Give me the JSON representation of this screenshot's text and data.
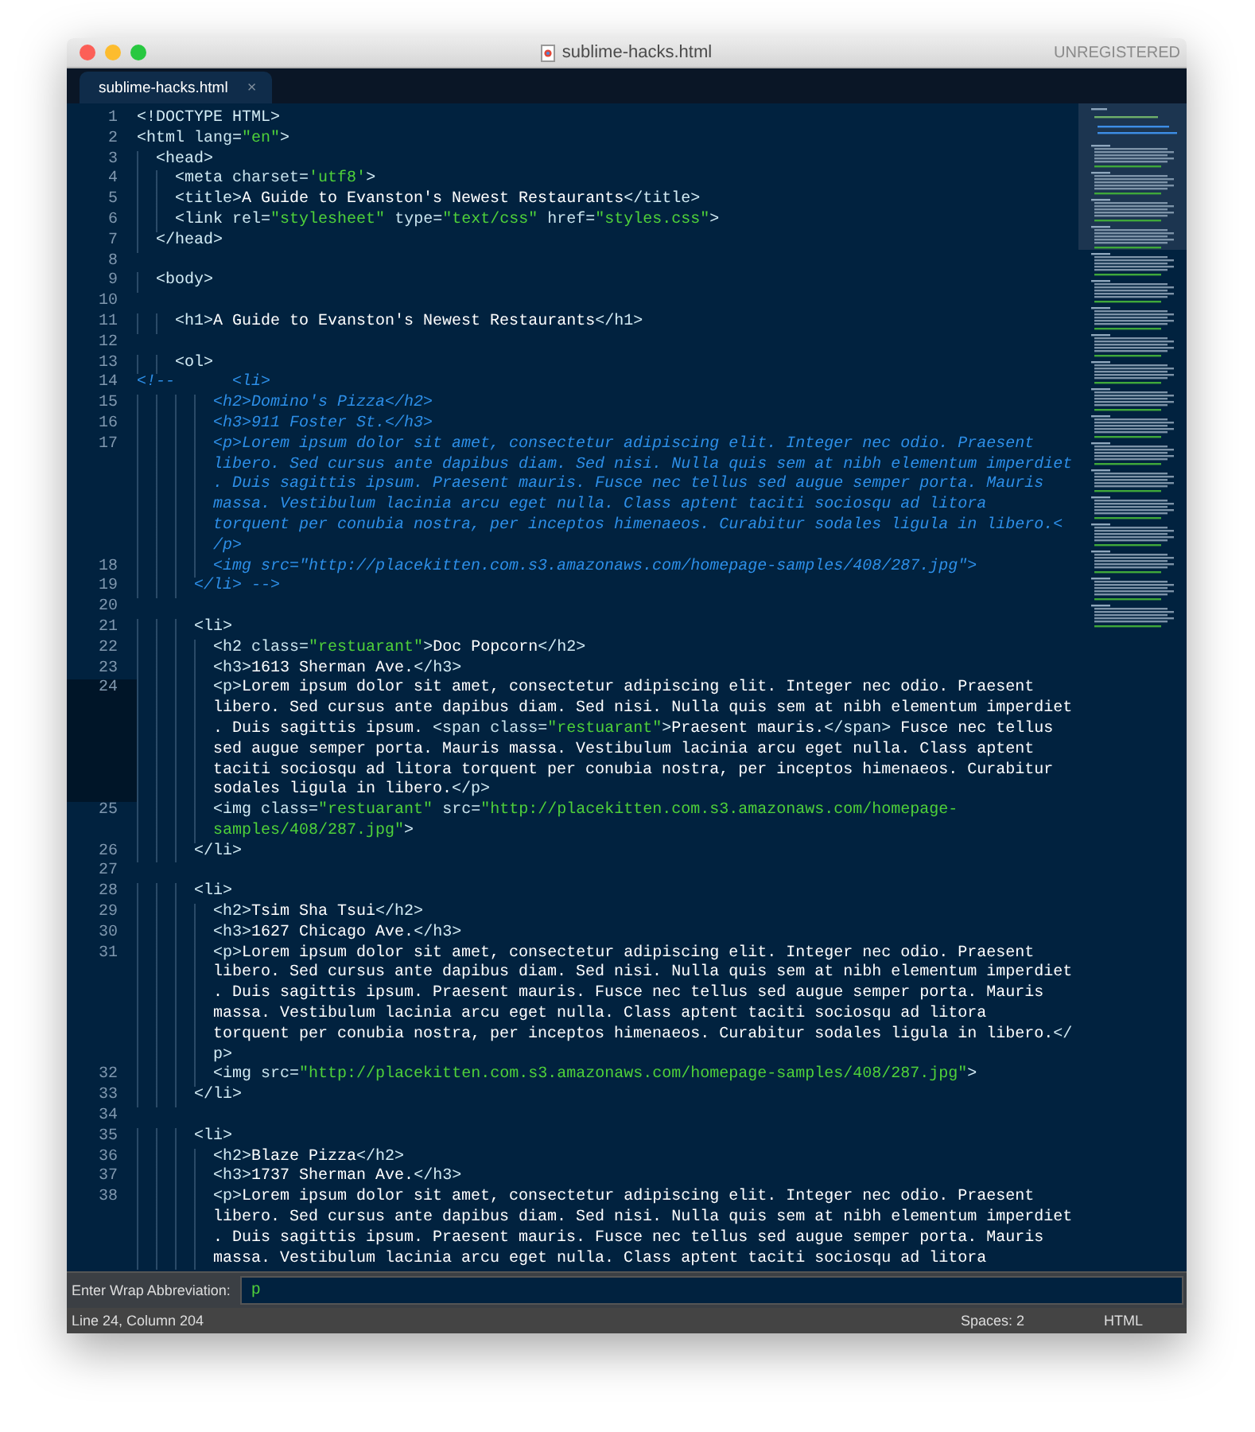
{
  "window": {
    "title": "sublime-hacks.html",
    "registration": "UNREGISTERED"
  },
  "tabs": [
    {
      "label": "sublime-hacks.html",
      "close": "×",
      "selected": true
    }
  ],
  "editor": {
    "lines": [
      {
        "number": "1",
        "current": false,
        "rows": [
          {
            "indent": "",
            "tokens": [
              {
                "kind": "tag",
                "text": "<!DOCTYPE HTML>"
              }
            ]
          }
        ]
      },
      {
        "number": "2",
        "current": false,
        "rows": [
          {
            "indent": "",
            "tokens": [
              {
                "kind": "tag",
                "text": "<html"
              },
              {
                "kind": "attr",
                "text": " lang="
              },
              {
                "kind": "string",
                "text": "\"en\""
              },
              {
                "kind": "tag",
                "text": ">"
              }
            ]
          }
        ]
      },
      {
        "number": "3",
        "current": false,
        "rows": [
          {
            "indent": "  ",
            "tokens": [
              {
                "kind": "tag",
                "text": "<head>"
              }
            ]
          }
        ]
      },
      {
        "number": "4",
        "current": false,
        "rows": [
          {
            "indent": "    ",
            "tokens": [
              {
                "kind": "tag",
                "text": "<meta"
              },
              {
                "kind": "attr",
                "text": " charset="
              },
              {
                "kind": "string",
                "text": "'utf8'"
              },
              {
                "kind": "tag",
                "text": ">"
              }
            ]
          }
        ]
      },
      {
        "number": "5",
        "current": false,
        "rows": [
          {
            "indent": "    ",
            "tokens": [
              {
                "kind": "tag",
                "text": "<title>"
              },
              {
                "kind": "text",
                "text": "A Guide to Evanston's Newest Restaurants"
              },
              {
                "kind": "tag",
                "text": "</title>"
              }
            ]
          }
        ]
      },
      {
        "number": "6",
        "current": false,
        "rows": [
          {
            "indent": "    ",
            "tokens": [
              {
                "kind": "tag",
                "text": "<link"
              },
              {
                "kind": "attr",
                "text": " rel="
              },
              {
                "kind": "string",
                "text": "\"stylesheet\""
              },
              {
                "kind": "attr",
                "text": " type="
              },
              {
                "kind": "string",
                "text": "\"text/css\""
              },
              {
                "kind": "attr",
                "text": " href="
              },
              {
                "kind": "string",
                "text": "\"styles.css\""
              },
              {
                "kind": "tag",
                "text": ">"
              }
            ]
          }
        ]
      },
      {
        "number": "7",
        "current": false,
        "rows": [
          {
            "indent": "  ",
            "tokens": [
              {
                "kind": "tag",
                "text": "</head>"
              }
            ]
          }
        ]
      },
      {
        "number": "8",
        "current": false
      },
      {
        "number": "9",
        "current": false,
        "rows": [
          {
            "indent": "  ",
            "tokens": [
              {
                "kind": "tag",
                "text": "<body>"
              }
            ]
          }
        ]
      },
      {
        "number": "10",
        "current": false
      },
      {
        "number": "11",
        "current": false,
        "rows": [
          {
            "indent": "    ",
            "tokens": [
              {
                "kind": "tag",
                "text": "<h1>"
              },
              {
                "kind": "text",
                "text": "A Guide to Evanston's Newest Restaurants"
              },
              {
                "kind": "tag",
                "text": "</h1>"
              }
            ]
          }
        ]
      },
      {
        "number": "12",
        "current": false
      },
      {
        "number": "13",
        "current": false,
        "rows": [
          {
            "indent": "    ",
            "tokens": [
              {
                "kind": "tag",
                "text": "<ol>"
              }
            ]
          }
        ]
      },
      {
        "number": "14",
        "current": false,
        "rows": [
          {
            "indent": "",
            "tokens": [
              {
                "kind": "comment",
                "text": "<!--      <li>"
              }
            ]
          }
        ]
      },
      {
        "number": "15",
        "current": false,
        "rows": [
          {
            "indent": "        ",
            "tokens": [
              {
                "kind": "comment",
                "text": "<h2>Domino's Pizza</h2>"
              }
            ]
          }
        ]
      },
      {
        "number": "16",
        "current": false,
        "rows": [
          {
            "indent": "        ",
            "tokens": [
              {
                "kind": "comment",
                "text": "<h3>911 Foster St.</h3>"
              }
            ]
          }
        ]
      },
      {
        "number": "17",
        "current": false,
        "rows": [
          {
            "indent": "        ",
            "tokens": [
              {
                "kind": "comment",
                "text": "<p>Lorem ipsum dolor sit amet, consectetur adipiscing elit. Integer nec odio. Praesent"
              }
            ]
          },
          {
            "indent": "        ",
            "tokens": [
              {
                "kind": "comment",
                "text": "libero. Sed cursus ante dapibus diam. Sed nisi. Nulla quis sem at nibh elementum imperdiet"
              }
            ]
          },
          {
            "indent": "        ",
            "tokens": [
              {
                "kind": "comment",
                "text": ". Duis sagittis ipsum. Praesent mauris. Fusce nec tellus sed augue semper porta. Mauris"
              }
            ]
          },
          {
            "indent": "        ",
            "tokens": [
              {
                "kind": "comment",
                "text": "massa. Vestibulum lacinia arcu eget nulla. Class aptent taciti sociosqu ad litora"
              }
            ]
          },
          {
            "indent": "        ",
            "tokens": [
              {
                "kind": "comment",
                "text": "torquent per conubia nostra, per inceptos himenaeos. Curabitur sodales ligula in libero.<"
              }
            ]
          },
          {
            "indent": "        ",
            "tokens": [
              {
                "kind": "comment",
                "text": "/p>"
              }
            ]
          }
        ]
      },
      {
        "number": "18",
        "current": false,
        "rows": [
          {
            "indent": "        ",
            "tokens": [
              {
                "kind": "comment",
                "text": "<img src=\"http://placekitten.com.s3.amazonaws.com/homepage-samples/408/287.jpg\">"
              }
            ]
          }
        ]
      },
      {
        "number": "19",
        "current": false,
        "rows": [
          {
            "indent": "      ",
            "tokens": [
              {
                "kind": "comment",
                "text": "</li> -->"
              }
            ]
          }
        ]
      },
      {
        "number": "20",
        "current": false
      },
      {
        "number": "21",
        "current": false,
        "rows": [
          {
            "indent": "      ",
            "tokens": [
              {
                "kind": "tag",
                "text": "<li>"
              }
            ]
          }
        ]
      },
      {
        "number": "22",
        "current": false,
        "rows": [
          {
            "indent": "        ",
            "tokens": [
              {
                "kind": "tag",
                "text": "<h2"
              },
              {
                "kind": "attr",
                "text": " class="
              },
              {
                "kind": "string",
                "text": "\"restuarant\""
              },
              {
                "kind": "tag",
                "text": ">"
              },
              {
                "kind": "text",
                "text": "Doc Popcorn"
              },
              {
                "kind": "tag",
                "text": "</h2>"
              }
            ]
          }
        ]
      },
      {
        "number": "23",
        "current": false,
        "rows": [
          {
            "indent": "        ",
            "tokens": [
              {
                "kind": "tag",
                "text": "<h3>"
              },
              {
                "kind": "text",
                "text": "1613 Sherman Ave."
              },
              {
                "kind": "tag",
                "text": "</h3>"
              }
            ]
          }
        ]
      },
      {
        "number": "24",
        "current": true,
        "rows": [
          {
            "indent": "        ",
            "tokens": [
              {
                "kind": "tag",
                "text": "<p>"
              },
              {
                "kind": "text",
                "text": "Lorem ipsum dolor sit amet, consectetur adipiscing elit. Integer nec odio. Praesent"
              }
            ]
          },
          {
            "indent": "        ",
            "tokens": [
              {
                "kind": "text",
                "text": "libero. Sed cursus ante dapibus diam. Sed nisi. Nulla quis sem at nibh elementum imperdiet"
              }
            ]
          },
          {
            "indent": "        ",
            "tokens": [
              {
                "kind": "text",
                "text": ". Duis sagittis ipsum. "
              },
              {
                "kind": "tag",
                "text": "<span"
              },
              {
                "kind": "attr",
                "text": " class="
              },
              {
                "kind": "string",
                "text": "\"restuarant\""
              },
              {
                "kind": "tag",
                "text": ">"
              },
              {
                "kind": "text",
                "text": "Praesent mauris."
              },
              {
                "kind": "tag",
                "text": "</span>"
              },
              {
                "kind": "text",
                "text": " Fusce nec tellus"
              }
            ]
          },
          {
            "indent": "        ",
            "tokens": [
              {
                "kind": "text",
                "text": "sed augue semper porta. Mauris massa. Vestibulum lacinia arcu eget nulla. Class aptent"
              }
            ]
          },
          {
            "indent": "        ",
            "tokens": [
              {
                "kind": "text",
                "text": "taciti sociosqu ad litora torquent per conubia nostra, per inceptos himenaeos. Curabitur"
              }
            ]
          },
          {
            "indent": "        ",
            "tokens": [
              {
                "kind": "text",
                "text": "sodales ligula in libero."
              },
              {
                "kind": "tag",
                "text": "</p>"
              }
            ]
          }
        ]
      },
      {
        "number": "25",
        "current": false,
        "rows": [
          {
            "indent": "        ",
            "tokens": [
              {
                "kind": "tag",
                "text": "<img"
              },
              {
                "kind": "attr",
                "text": " class="
              },
              {
                "kind": "string",
                "text": "\"restuarant\""
              },
              {
                "kind": "attr",
                "text": " src="
              },
              {
                "kind": "string",
                "text": "\"http://placekitten.com.s3.amazonaws.com/homepage-"
              }
            ]
          },
          {
            "indent": "        ",
            "tokens": [
              {
                "kind": "string",
                "text": "samples/408/287.jpg\""
              },
              {
                "kind": "tag",
                "text": ">"
              }
            ]
          }
        ]
      },
      {
        "number": "26",
        "current": false,
        "rows": [
          {
            "indent": "      ",
            "tokens": [
              {
                "kind": "tag",
                "text": "</li>"
              }
            ]
          }
        ]
      },
      {
        "number": "27",
        "current": false
      },
      {
        "number": "28",
        "current": false,
        "rows": [
          {
            "indent": "      ",
            "tokens": [
              {
                "kind": "tag",
                "text": "<li>"
              }
            ]
          }
        ]
      },
      {
        "number": "29",
        "current": false,
        "rows": [
          {
            "indent": "        ",
            "tokens": [
              {
                "kind": "tag",
                "text": "<h2>"
              },
              {
                "kind": "text",
                "text": "Tsim Sha Tsui"
              },
              {
                "kind": "tag",
                "text": "</h2>"
              }
            ]
          }
        ]
      },
      {
        "number": "30",
        "current": false,
        "rows": [
          {
            "indent": "        ",
            "tokens": [
              {
                "kind": "tag",
                "text": "<h3>"
              },
              {
                "kind": "text",
                "text": "1627 Chicago Ave."
              },
              {
                "kind": "tag",
                "text": "</h3>"
              }
            ]
          }
        ]
      },
      {
        "number": "31",
        "current": false,
        "rows": [
          {
            "indent": "        ",
            "tokens": [
              {
                "kind": "tag",
                "text": "<p>"
              },
              {
                "kind": "text",
                "text": "Lorem ipsum dolor sit amet, consectetur adipiscing elit. Integer nec odio. Praesent"
              }
            ]
          },
          {
            "indent": "        ",
            "tokens": [
              {
                "kind": "text",
                "text": "libero. Sed cursus ante dapibus diam. Sed nisi. Nulla quis sem at nibh elementum imperdiet"
              }
            ]
          },
          {
            "indent": "        ",
            "tokens": [
              {
                "kind": "text",
                "text": ". Duis sagittis ipsum. Praesent mauris. Fusce nec tellus sed augue semper porta. Mauris"
              }
            ]
          },
          {
            "indent": "        ",
            "tokens": [
              {
                "kind": "text",
                "text": "massa. Vestibulum lacinia arcu eget nulla. Class aptent taciti sociosqu ad litora"
              }
            ]
          },
          {
            "indent": "        ",
            "tokens": [
              {
                "kind": "text",
                "text": "torquent per conubia nostra, per inceptos himenaeos. Curabitur sodales ligula in libero."
              },
              {
                "kind": "tag",
                "text": "</"
              }
            ]
          },
          {
            "indent": "        ",
            "tokens": [
              {
                "kind": "tag",
                "text": "p>"
              }
            ]
          }
        ]
      },
      {
        "number": "32",
        "current": false,
        "rows": [
          {
            "indent": "        ",
            "tokens": [
              {
                "kind": "tag",
                "text": "<img"
              },
              {
                "kind": "attr",
                "text": " src="
              },
              {
                "kind": "string",
                "text": "\"http://placekitten.com.s3.amazonaws.com/homepage-samples/408/287.jpg\""
              },
              {
                "kind": "tag",
                "text": ">"
              }
            ]
          }
        ]
      },
      {
        "number": "33",
        "current": false,
        "rows": [
          {
            "indent": "      ",
            "tokens": [
              {
                "kind": "tag",
                "text": "</li>"
              }
            ]
          }
        ]
      },
      {
        "number": "34",
        "current": false
      },
      {
        "number": "35",
        "current": false,
        "rows": [
          {
            "indent": "      ",
            "tokens": [
              {
                "kind": "tag",
                "text": "<li>"
              }
            ]
          }
        ]
      },
      {
        "number": "36",
        "current": false,
        "rows": [
          {
            "indent": "        ",
            "tokens": [
              {
                "kind": "tag",
                "text": "<h2>"
              },
              {
                "kind": "text",
                "text": "Blaze Pizza"
              },
              {
                "kind": "tag",
                "text": "</h2>"
              }
            ]
          }
        ]
      },
      {
        "number": "37",
        "current": false,
        "rows": [
          {
            "indent": "        ",
            "tokens": [
              {
                "kind": "tag",
                "text": "<h3>"
              },
              {
                "kind": "text",
                "text": "1737 Sherman Ave."
              },
              {
                "kind": "tag",
                "text": "</h3>"
              }
            ]
          }
        ]
      },
      {
        "number": "38",
        "current": false,
        "rows": [
          {
            "indent": "        ",
            "tokens": [
              {
                "kind": "tag",
                "text": "<p>"
              },
              {
                "kind": "text",
                "text": "Lorem ipsum dolor sit amet, consectetur adipiscing elit. Integer nec odio. Praesent"
              }
            ]
          },
          {
            "indent": "        ",
            "tokens": [
              {
                "kind": "text",
                "text": "libero. Sed cursus ante dapibus diam. Sed nisi. Nulla quis sem at nibh elementum imperdiet"
              }
            ]
          },
          {
            "indent": "        ",
            "tokens": [
              {
                "kind": "text",
                "text": ". Duis sagittis ipsum. Praesent mauris. Fusce nec tellus sed augue semper porta. Mauris"
              }
            ]
          },
          {
            "indent": "        ",
            "tokens": [
              {
                "kind": "text",
                "text": "massa. Vestibulum lacinia arcu eget nulla. Class aptent taciti sociosqu ad litora"
              }
            ]
          }
        ]
      }
    ]
  },
  "input_panel": {
    "label": "Enter Wrap Abbreviation:",
    "value": "p"
  },
  "status_bar": {
    "position": "Line 24, Column 204",
    "indentation": "Spaces: 2",
    "syntax": "HTML"
  }
}
